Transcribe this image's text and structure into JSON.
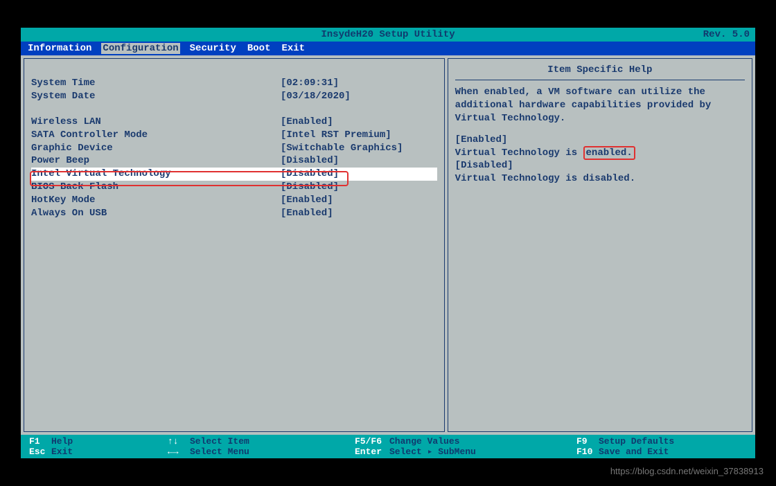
{
  "title": "InsydeH20 Setup Utility",
  "revision": "Rev. 5.0",
  "menu": {
    "information": "Information",
    "configuration": "Configuration",
    "security": "Security",
    "boot": "Boot",
    "exit": "Exit"
  },
  "settings": {
    "system_time": {
      "label": "System Time",
      "value": "[02:09:31]"
    },
    "system_date": {
      "label": "System Date",
      "value": "[03/18/2020]"
    },
    "wireless_lan": {
      "label": "Wireless LAN",
      "value": "[Enabled]"
    },
    "sata_controller": {
      "label": "SATA Controller Mode",
      "value": "[Intel RST Premium]"
    },
    "graphic_device": {
      "label": "Graphic Device",
      "value": "[Switchable Graphics]"
    },
    "power_beep": {
      "label": "Power Beep",
      "value": "[Disabled]"
    },
    "intel_vt": {
      "label": "Intel Virtual Technology",
      "value": "[Disabled]"
    },
    "bios_back_flash": {
      "label": "BIOS Back Flash",
      "value": "[Disabled]"
    },
    "hotkey_mode": {
      "label": "HotKey Mode",
      "value": "[Enabled]"
    },
    "always_on_usb": {
      "label": "Always On USB",
      "value": "[Enabled]"
    }
  },
  "help": {
    "title": "Item Specific Help",
    "desc": "When enabled, a VM software can utilize the additional hardware capabilities provided by Virtual Technology.",
    "enabled_label": "[Enabled]",
    "enabled_text_prefix": "Virtual Technology is ",
    "enabled_word": "enabled.",
    "disabled_label": "[Disabled]",
    "disabled_text": "Virtual Technology is disabled."
  },
  "footer": {
    "f1": {
      "key": "F1",
      "label": "Help"
    },
    "esc": {
      "key": "Esc",
      "label": "Exit"
    },
    "updown": {
      "key": "↑↓",
      "label": "Select Item"
    },
    "leftright": {
      "key": "←→",
      "label": "Select Menu"
    },
    "f5f6": {
      "key": "F5/F6",
      "label": "Change Values"
    },
    "enter": {
      "key": "Enter",
      "label": "Select ▸ SubMenu"
    },
    "f9": {
      "key": "F9",
      "label": "Setup Defaults"
    },
    "f10": {
      "key": "F10",
      "label": "Save and Exit"
    }
  },
  "watermark": "https://blog.csdn.net/weixin_37838913"
}
